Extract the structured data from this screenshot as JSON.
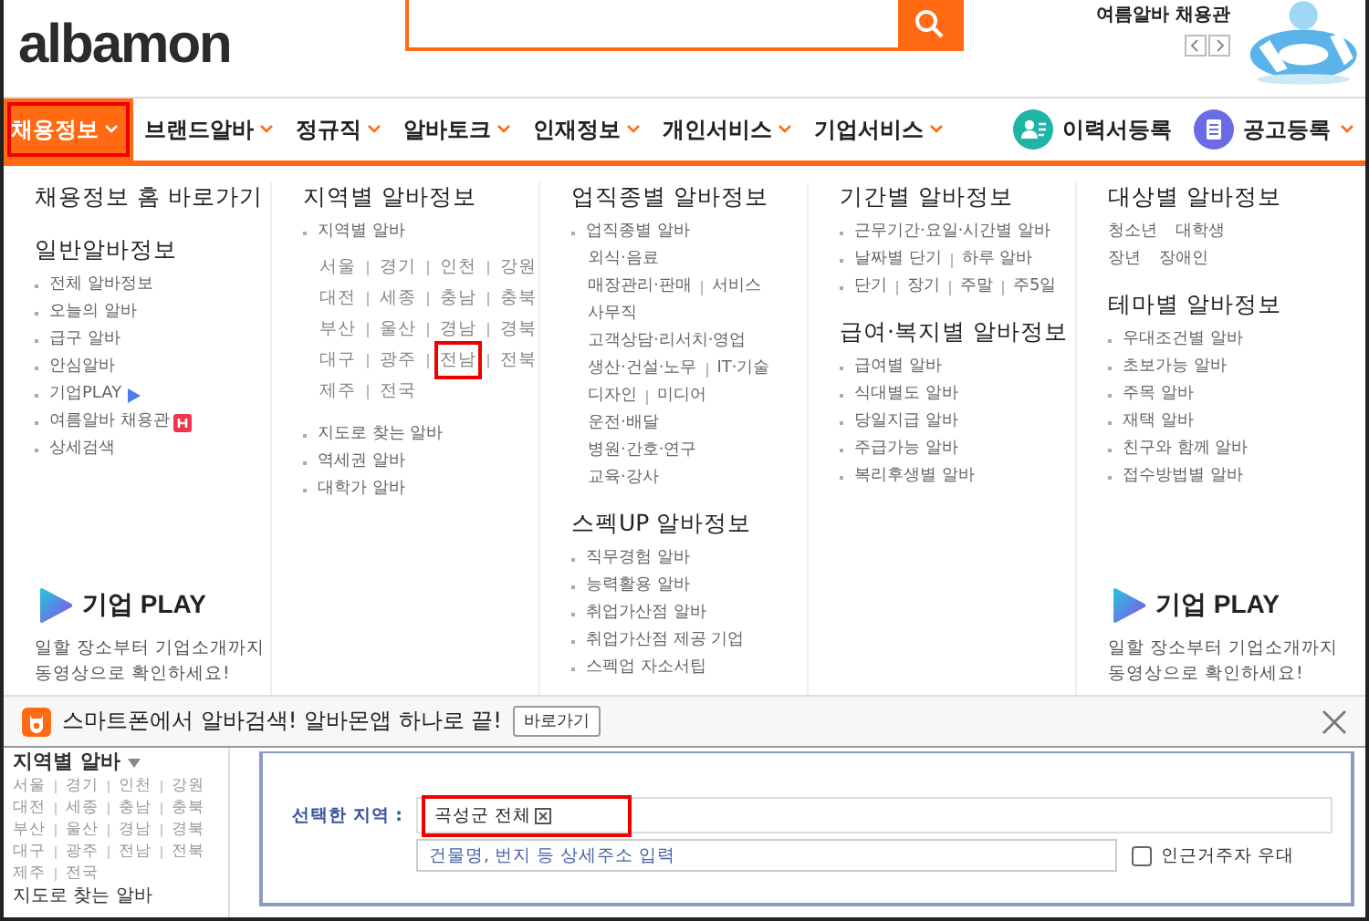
{
  "header": {
    "logo": "albamon",
    "promo_title": "여름알바 채용관"
  },
  "nav": {
    "items": [
      {
        "label": "채용정보",
        "selected": true,
        "highlighted": true
      },
      {
        "label": "브랜드알바",
        "selected": false,
        "highlighted": false
      },
      {
        "label": "정규직",
        "selected": false,
        "highlighted": false
      },
      {
        "label": "알바토크",
        "selected": false,
        "highlighted": false
      },
      {
        "label": "인재정보",
        "selected": false,
        "highlighted": false
      },
      {
        "label": "개인서비스",
        "selected": false,
        "highlighted": false
      },
      {
        "label": "기업서비스",
        "selected": false,
        "highlighted": false
      }
    ],
    "actions": [
      {
        "label": "이력서등록",
        "kind": "resume"
      },
      {
        "label": "공고등록",
        "kind": "post"
      }
    ]
  },
  "menu": {
    "columns": [
      {
        "sections": [
          {
            "title": "채용정보 홈 바로가기"
          },
          {
            "title": "일반알바정보",
            "items": [
              {
                "kind": "bullet",
                "words": [
                  "전체 알바정보"
                ]
              },
              {
                "kind": "bullet",
                "words": [
                  "오늘의 알바"
                ]
              },
              {
                "kind": "bullet",
                "words": [
                  "급구 알바"
                ]
              },
              {
                "kind": "bullet",
                "words": [
                  "안심알바"
                ]
              },
              {
                "kind": "playlink",
                "words": [
                  "기업PLAY"
                ]
              },
              {
                "kind": "hotlink",
                "words": [
                  "여름알바 채용관"
                ]
              },
              {
                "kind": "bullet",
                "words": [
                  "상세검색"
                ]
              }
            ]
          }
        ],
        "promo": {
          "title": "기업 PLAY",
          "lines": [
            "일할 장소부터 기업소개까지",
            "동영상으로 확인하세요!"
          ]
        }
      },
      {
        "sections": [
          {
            "title": "지역별 알바정보",
            "items": [
              {
                "kind": "bullet",
                "words": [
                  "지역별 알바"
                ]
              },
              {
                "kind": "regions",
                "rows": [
                  [
                    {
                      "text": "서울",
                      "highlighted": false
                    },
                    {
                      "text": "경기",
                      "highlighted": false
                    },
                    {
                      "text": "인천",
                      "highlighted": false
                    },
                    {
                      "text": "강원",
                      "highlighted": false
                    }
                  ],
                  [
                    {
                      "text": "대전",
                      "highlighted": false
                    },
                    {
                      "text": "세종",
                      "highlighted": false
                    },
                    {
                      "text": "충남",
                      "highlighted": false
                    },
                    {
                      "text": "충북",
                      "highlighted": false
                    }
                  ],
                  [
                    {
                      "text": "부산",
                      "highlighted": false
                    },
                    {
                      "text": "울산",
                      "highlighted": false
                    },
                    {
                      "text": "경남",
                      "highlighted": false
                    },
                    {
                      "text": "경북",
                      "highlighted": false
                    }
                  ],
                  [
                    {
                      "text": "대구",
                      "highlighted": false
                    },
                    {
                      "text": "광주",
                      "highlighted": false
                    },
                    {
                      "text": "전남",
                      "highlighted": true
                    },
                    {
                      "text": "전북",
                      "highlighted": false
                    }
                  ],
                  [
                    {
                      "text": "제주",
                      "highlighted": false
                    },
                    {
                      "text": "전국",
                      "highlighted": false
                    }
                  ]
                ]
              },
              {
                "kind": "bullet",
                "words": [
                  "지도로 찾는 알바"
                ]
              },
              {
                "kind": "bullet",
                "words": [
                  "역세권 알바"
                ]
              },
              {
                "kind": "bullet",
                "words": [
                  "대학가 알바"
                ]
              }
            ]
          }
        ]
      },
      {
        "sections": [
          {
            "title": "업직종별 알바정보",
            "items": [
              {
                "kind": "bullet",
                "words": [
                  "업직종별 알바"
                ]
              },
              {
                "kind": "plain",
                "words": [
                  "외식·음료"
                ]
              },
              {
                "kind": "plain",
                "words": [
                  "매장관리·판매",
                  "서비스"
                ]
              },
              {
                "kind": "plain",
                "words": [
                  "사무직"
                ]
              },
              {
                "kind": "plain",
                "words": [
                  "고객상담·리서치·영업"
                ]
              },
              {
                "kind": "plain",
                "words": [
                  "생산·건설·노무",
                  "IT·기술"
                ]
              },
              {
                "kind": "plain",
                "words": [
                  "디자인",
                  "미디어"
                ]
              },
              {
                "kind": "plain",
                "words": [
                  "운전·배달"
                ]
              },
              {
                "kind": "plain",
                "words": [
                  "병원·간호·연구"
                ]
              },
              {
                "kind": "plain",
                "words": [
                  "교육·강사"
                ]
              }
            ]
          },
          {
            "title": "스펙UP 알바정보",
            "items": [
              {
                "kind": "bullet",
                "words": [
                  "직무경험 알바"
                ]
              },
              {
                "kind": "bullet",
                "words": [
                  "능력활용 알바"
                ]
              },
              {
                "kind": "bullet",
                "words": [
                  "취업가산점 알바"
                ]
              },
              {
                "kind": "bullet",
                "words": [
                  "취업가산점 제공 기업"
                ]
              },
              {
                "kind": "bullet",
                "words": [
                  "스펙업 자소서팁"
                ]
              }
            ]
          }
        ]
      },
      {
        "sections": [
          {
            "title": "기간별 알바정보",
            "items": [
              {
                "kind": "bullet",
                "words": [
                  "근무기간·요일·시간별 알바"
                ]
              },
              {
                "kind": "bullet",
                "words": [
                  "날짜별 단기",
                  "하루 알바"
                ]
              },
              {
                "kind": "bullet",
                "words": [
                  "단기",
                  "장기",
                  "주말",
                  "주5일"
                ]
              }
            ]
          },
          {
            "title": "급여·복지별 알바정보",
            "items": [
              {
                "kind": "bullet",
                "words": [
                  "급여별 알바"
                ]
              },
              {
                "kind": "bullet",
                "words": [
                  "식대별도 알바"
                ]
              },
              {
                "kind": "bullet",
                "words": [
                  "당일지급 알바"
                ]
              },
              {
                "kind": "bullet",
                "words": [
                  "주급가능 알바"
                ]
              },
              {
                "kind": "bullet",
                "words": [
                  "복리후생별 알바"
                ]
              }
            ]
          }
        ]
      },
      {
        "sections": [
          {
            "title": "대상별 알바정보",
            "items": [
              {
                "kind": "pair",
                "words": [
                  "청소년",
                  "대학생"
                ]
              },
              {
                "kind": "pair",
                "words": [
                  "장년",
                  "장애인"
                ]
              }
            ]
          },
          {
            "title": "테마별 알바정보",
            "items": [
              {
                "kind": "bullet",
                "words": [
                  "우대조건별 알바"
                ]
              },
              {
                "kind": "bullet",
                "words": [
                  "초보가능 알바"
                ]
              },
              {
                "kind": "bullet",
                "words": [
                  "주목 알바"
                ]
              },
              {
                "kind": "bullet",
                "words": [
                  "재택 알바"
                ]
              },
              {
                "kind": "bullet",
                "words": [
                  "친구와 함께 알바"
                ]
              },
              {
                "kind": "bullet",
                "words": [
                  "접수방법별 알바"
                ]
              }
            ]
          }
        ],
        "promo": {
          "title": "기업 PLAY",
          "lines": [
            "일할 장소부터 기업소개까지",
            "동영상으로 확인하세요!"
          ]
        }
      }
    ]
  },
  "banner": {
    "text": "스마트폰에서 알바검색! 알바몬앱 하나로 끝!",
    "button": "바로가기"
  },
  "sidebar": {
    "title": "지역별 알바",
    "rows": [
      [
        "서울",
        "경기",
        "인천",
        "강원"
      ],
      [
        "대전",
        "세종",
        "충남",
        "충북"
      ],
      [
        "부산",
        "울산",
        "경남",
        "경북"
      ],
      [
        "대구",
        "광주",
        "전남",
        "전북"
      ],
      [
        "제주",
        "전국"
      ]
    ],
    "more": "지도로 찾는 알바"
  },
  "form": {
    "label": "선택한 지역 :",
    "tags": [
      {
        "text": "곡성군 전체",
        "highlighted": true
      }
    ],
    "address_placeholder": "건물명, 번지 등 상세주소 입력",
    "nearby": {
      "label": "인근거주자 우대",
      "checked": false
    }
  }
}
